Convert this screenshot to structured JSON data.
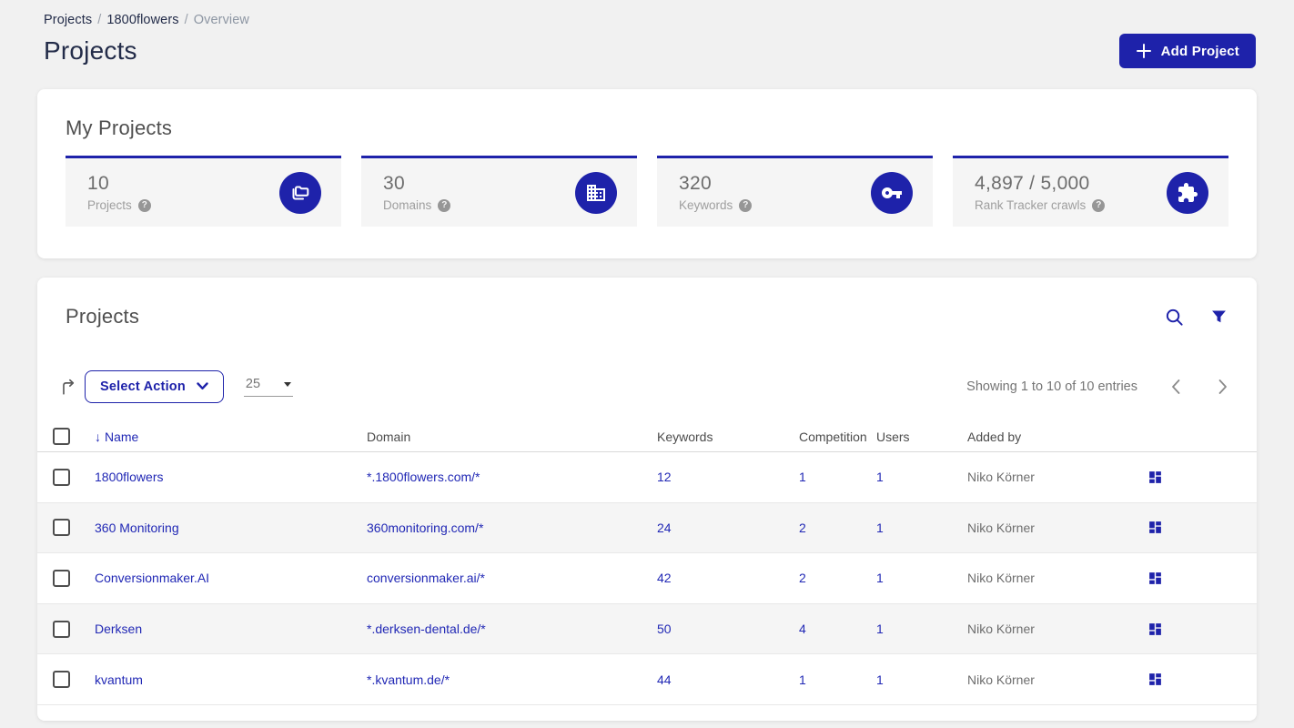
{
  "page": {
    "breadcrumb": {
      "items": [
        "Projects",
        "1800flowers",
        "Overview"
      ],
      "separator": "/"
    },
    "title": "Projects",
    "add_project_label": "Add Project"
  },
  "colors": {
    "brand_blue": "#1e22aa",
    "link_blue": "#2128b5",
    "stripe_gray": "#f5f5f5",
    "page_bg": "#f1f1f1"
  },
  "my_projects": {
    "title": "My Projects",
    "stats": [
      {
        "value": "10",
        "label": "Projects",
        "icon": "projects-icon"
      },
      {
        "value": "30",
        "label": "Domains",
        "icon": "domains-icon"
      },
      {
        "value": "320",
        "label": "Keywords",
        "icon": "key-icon"
      },
      {
        "value": "4,897 / 5,000",
        "label": "Rank Tracker crawls",
        "icon": "puzzle-icon"
      }
    ],
    "help_glyph": "?"
  },
  "projects_table": {
    "title": "Projects",
    "select_action_label": "Select Action",
    "page_size": "25",
    "showing_text": "Showing 1 to 10 of 10 entries",
    "columns": [
      "Name",
      "Domain",
      "Keywords",
      "Competition",
      "Users",
      "Added by"
    ],
    "sort_glyph": "↓",
    "rows": [
      {
        "name": "1800flowers",
        "domain": "*.1800flowers.com/*",
        "keywords": "12",
        "competition": "1",
        "users": "1",
        "added_by": "Niko Körner"
      },
      {
        "name": "360 Monitoring",
        "domain": "360monitoring.com/*",
        "keywords": "24",
        "competition": "2",
        "users": "1",
        "added_by": "Niko Körner"
      },
      {
        "name": "Conversionmaker.AI",
        "domain": "conversionmaker.ai/*",
        "keywords": "42",
        "competition": "2",
        "users": "1",
        "added_by": "Niko Körner"
      },
      {
        "name": "Derksen",
        "domain": "*.derksen-dental.de/*",
        "keywords": "50",
        "competition": "4",
        "users": "1",
        "added_by": "Niko Körner"
      },
      {
        "name": "kvantum",
        "domain": "*.kvantum.de/*",
        "keywords": "44",
        "competition": "1",
        "users": "1",
        "added_by": "Niko Körner"
      }
    ]
  }
}
